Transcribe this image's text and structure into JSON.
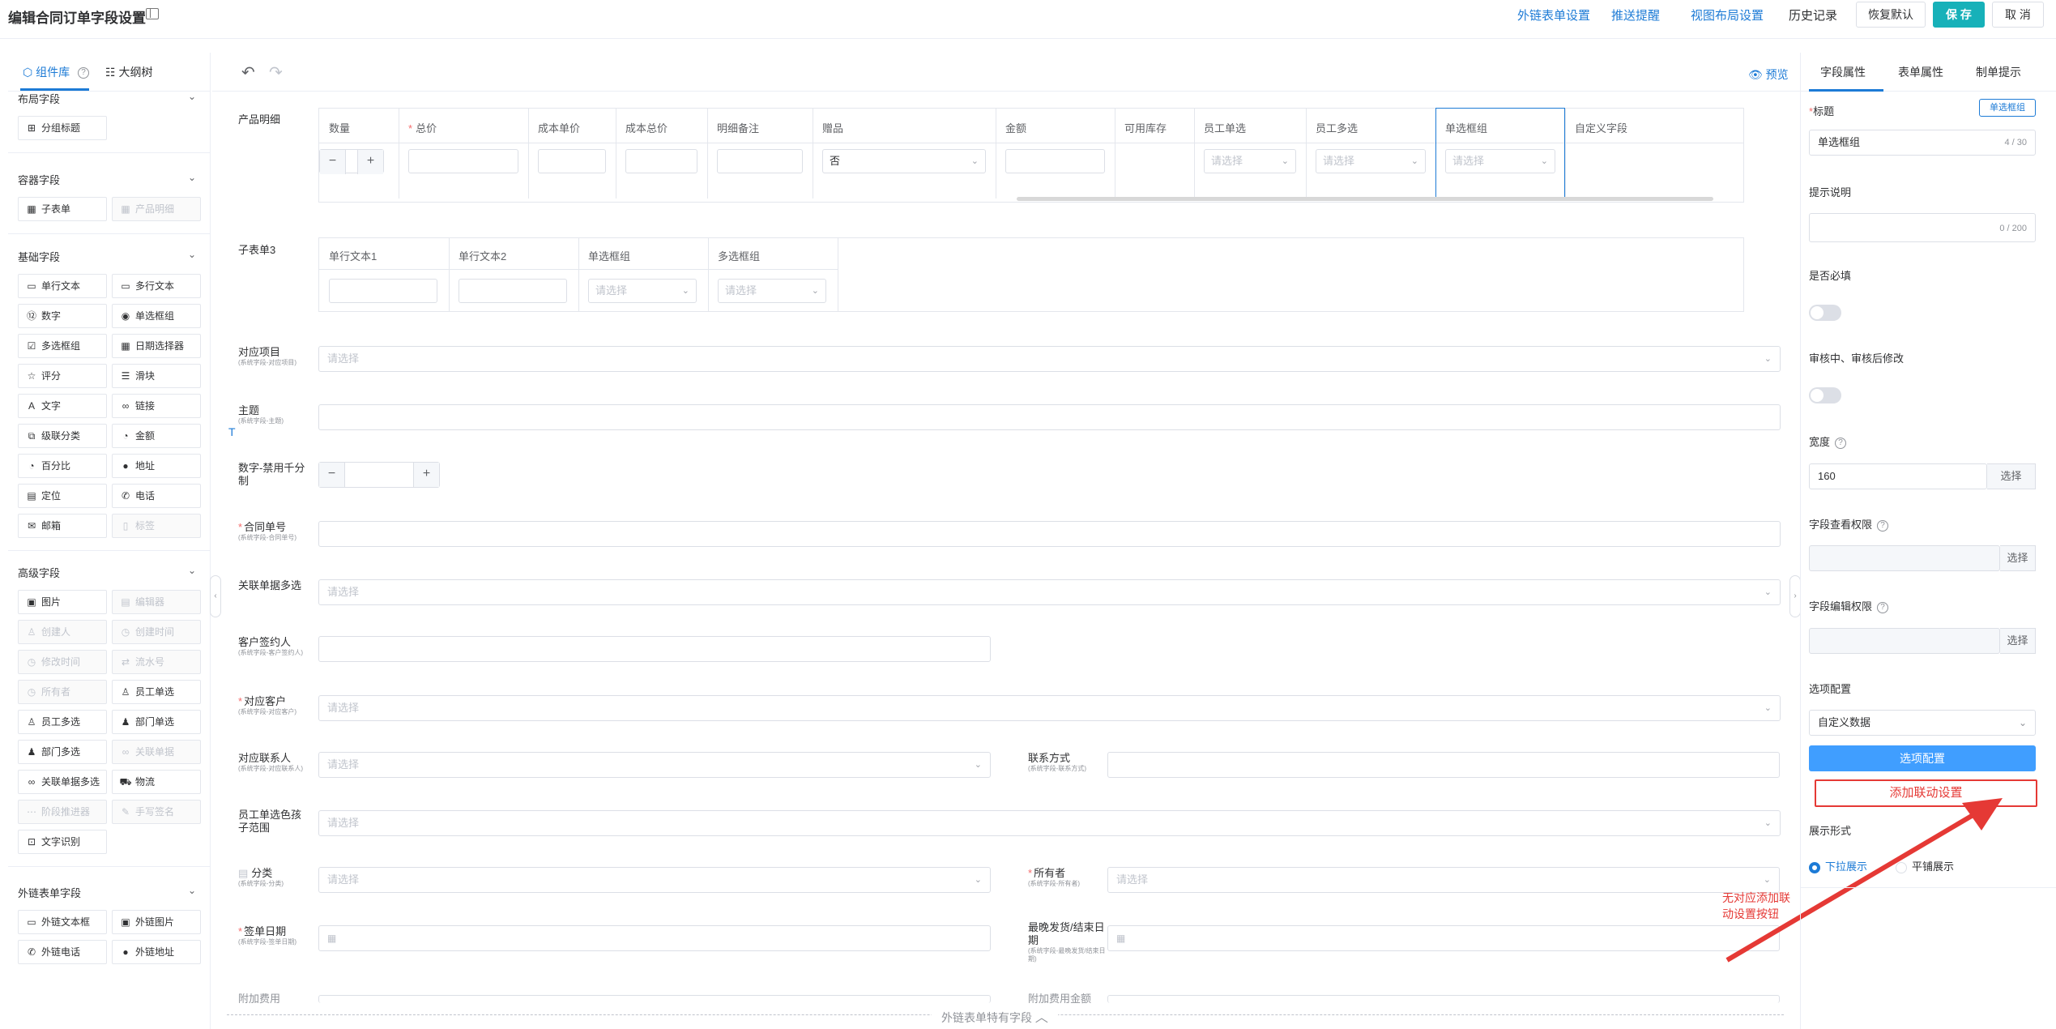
{
  "header": {
    "title": "编辑合同订单字段设置",
    "links": [
      "外链表单设置",
      "推送提醒",
      "视图布局设置",
      "历史记录"
    ],
    "restore_label": "恢复默认",
    "save_label": "保 存",
    "cancel_label": "取 消"
  },
  "left_panel": {
    "tab_components": "组件库",
    "tab_outline": "大纲树",
    "groups": [
      {
        "title": "布局字段",
        "items": [
          {
            "label": "分组标题",
            "icon": "⊞",
            "disabled": false
          }
        ]
      },
      {
        "title": "容器字段",
        "items": [
          {
            "label": "子表单",
            "icon": "▦",
            "disabled": false
          },
          {
            "label": "产品明细",
            "icon": "▦",
            "disabled": true
          }
        ]
      },
      {
        "title": "基础字段",
        "items": [
          {
            "label": "单行文本",
            "icon": "▭",
            "disabled": false
          },
          {
            "label": "多行文本",
            "icon": "▭",
            "disabled": false
          },
          {
            "label": "数字",
            "icon": "⑫",
            "disabled": false
          },
          {
            "label": "单选框组",
            "icon": "◉",
            "disabled": false
          },
          {
            "label": "多选框组",
            "icon": "☑",
            "disabled": false
          },
          {
            "label": "日期选择器",
            "icon": "▦",
            "disabled": false
          },
          {
            "label": "评分",
            "icon": "☆",
            "disabled": false
          },
          {
            "label": "滑块",
            "icon": "☰",
            "disabled": false
          },
          {
            "label": "文字",
            "icon": "A",
            "disabled": false
          },
          {
            "label": "链接",
            "icon": "∞",
            "disabled": false
          },
          {
            "label": "级联分类",
            "icon": "⧉",
            "disabled": false
          },
          {
            "label": "金额",
            "icon": "◔",
            "disabled": false
          },
          {
            "label": "百分比",
            "icon": "◔",
            "disabled": false
          },
          {
            "label": "地址",
            "icon": "●",
            "disabled": false
          },
          {
            "label": "定位",
            "icon": "▤",
            "disabled": false
          },
          {
            "label": "电话",
            "icon": "✆",
            "disabled": false
          },
          {
            "label": "邮箱",
            "icon": "✉",
            "disabled": false
          },
          {
            "label": "标签",
            "icon": "▯",
            "disabled": true
          }
        ]
      },
      {
        "title": "高级字段",
        "items": [
          {
            "label": "图片",
            "icon": "▣",
            "disabled": false
          },
          {
            "label": "编辑器",
            "icon": "▤",
            "disabled": true
          },
          {
            "label": "创建人",
            "icon": "♙",
            "disabled": true
          },
          {
            "label": "创建时间",
            "icon": "◷",
            "disabled": true
          },
          {
            "label": "修改时间",
            "icon": "◷",
            "disabled": true
          },
          {
            "label": "流水号",
            "icon": "⇄",
            "disabled": true
          },
          {
            "label": "所有者",
            "icon": "◷",
            "disabled": true
          },
          {
            "label": "员工单选",
            "icon": "♙",
            "disabled": false
          },
          {
            "label": "员工多选",
            "icon": "♙",
            "disabled": false
          },
          {
            "label": "部门单选",
            "icon": "♟",
            "disabled": false
          },
          {
            "label": "部门多选",
            "icon": "♟",
            "disabled": false
          },
          {
            "label": "关联单据",
            "icon": "∞",
            "disabled": true
          },
          {
            "label": "关联单据多选",
            "icon": "∞",
            "disabled": false
          },
          {
            "label": "物流",
            "icon": "⛟",
            "disabled": false
          },
          {
            "label": "阶段推进器",
            "icon": "⋯",
            "disabled": true
          },
          {
            "label": "手写签名",
            "icon": "✎",
            "disabled": true
          },
          {
            "label": "文字识别",
            "icon": "⊡",
            "disabled": false
          }
        ]
      },
      {
        "title": "外链表单字段",
        "items": [
          {
            "label": "外链文本框",
            "icon": "▭",
            "disabled": false
          },
          {
            "label": "外链图片",
            "icon": "▣",
            "disabled": false
          },
          {
            "label": "外链电话",
            "icon": "✆",
            "disabled": false
          },
          {
            "label": "外链地址",
            "icon": "●",
            "disabled": false
          }
        ]
      }
    ]
  },
  "center": {
    "preview_label": "预览",
    "product_detail": {
      "label": "产品明细",
      "columns": [
        "数量",
        "总价",
        "成本单价",
        "成本总价",
        "明细备注",
        "赠品",
        "金额",
        "可用库存",
        "员工单选",
        "员工多选",
        "单选框组",
        "自定义字段"
      ],
      "gift_value": "否",
      "placeholder": "请选择"
    },
    "subform3": {
      "label": "子表单3",
      "columns": [
        "单行文本1",
        "单行文本2",
        "单选框组",
        "多选框组"
      ],
      "placeholder": "请选择"
    },
    "fields": {
      "project": {
        "label": "对应项目",
        "sub": "(系统字段-对应项目)",
        "placeholder": "请选择"
      },
      "subject": {
        "label": "主题",
        "sub": "(系统字段-主题)"
      },
      "number_nosep": {
        "label": "数字-禁用千分制"
      },
      "contract_no": {
        "label": "合同单号",
        "sub": "(系统字段-合同单号)"
      },
      "related_multi": {
        "label": "关联单据多选",
        "placeholder": "请选择"
      },
      "signer": {
        "label": "客户签约人",
        "sub": "(系统字段-客户签约人)"
      },
      "customer": {
        "label": "对应客户",
        "sub": "(系统字段-对应客户)",
        "placeholder": "请选择"
      },
      "contact": {
        "label": "对应联系人",
        "sub": "(系统字段-对应联系人)",
        "placeholder": "请选择"
      },
      "contact_way": {
        "label": "联系方式",
        "sub": "(系统字段-联系方式)"
      },
      "emp_scope": {
        "label": "员工单选色孩子范围",
        "placeholder": "请选择"
      },
      "category": {
        "label": "分类",
        "sub": "(系统字段-分类)",
        "placeholder": "请选择"
      },
      "owner": {
        "label": "所有者",
        "sub": "(系统字段-所有者)",
        "placeholder": "请选择"
      },
      "sign_date": {
        "label": "签单日期",
        "sub": "(系统字段-签单日期)"
      },
      "latest_ship": {
        "label": "最晚发货/结束日期",
        "sub": "(系统字段-最晚发货/结束日期)"
      },
      "extra_fee": {
        "label": "附加费用"
      },
      "extra_fee_amount": {
        "label": "附加费用金额"
      }
    },
    "bottom_divider": "外链表单特有字段",
    "annotation": "无对应添加联动设置按钮"
  },
  "right_panel": {
    "tabs": [
      "字段属性",
      "表单属性",
      "制单提示"
    ],
    "title_label": "标题",
    "title_badge": "单选框组",
    "title_value": "单选框组",
    "title_counter": "4 / 30",
    "hint_label": "提示说明",
    "hint_counter": "0 / 200",
    "required_label": "是否必填",
    "review_label": "审核中、审核后修改",
    "width_label": "宽度",
    "width_value": "160",
    "width_select": "选择",
    "view_perm_label": "字段查看权限",
    "view_perm_select": "选择",
    "edit_perm_label": "字段编辑权限",
    "edit_perm_select": "选择",
    "options_label": "选项配置",
    "options_value": "自定义数据",
    "options_button": "选项配置",
    "linkage_button": "添加联动设置",
    "display_label": "展示形式",
    "display_options": [
      "下拉展示",
      "平铺展示"
    ],
    "colors": {
      "primary": "#409eff",
      "accent": "#17b1b9",
      "danger": "#e53935"
    }
  }
}
